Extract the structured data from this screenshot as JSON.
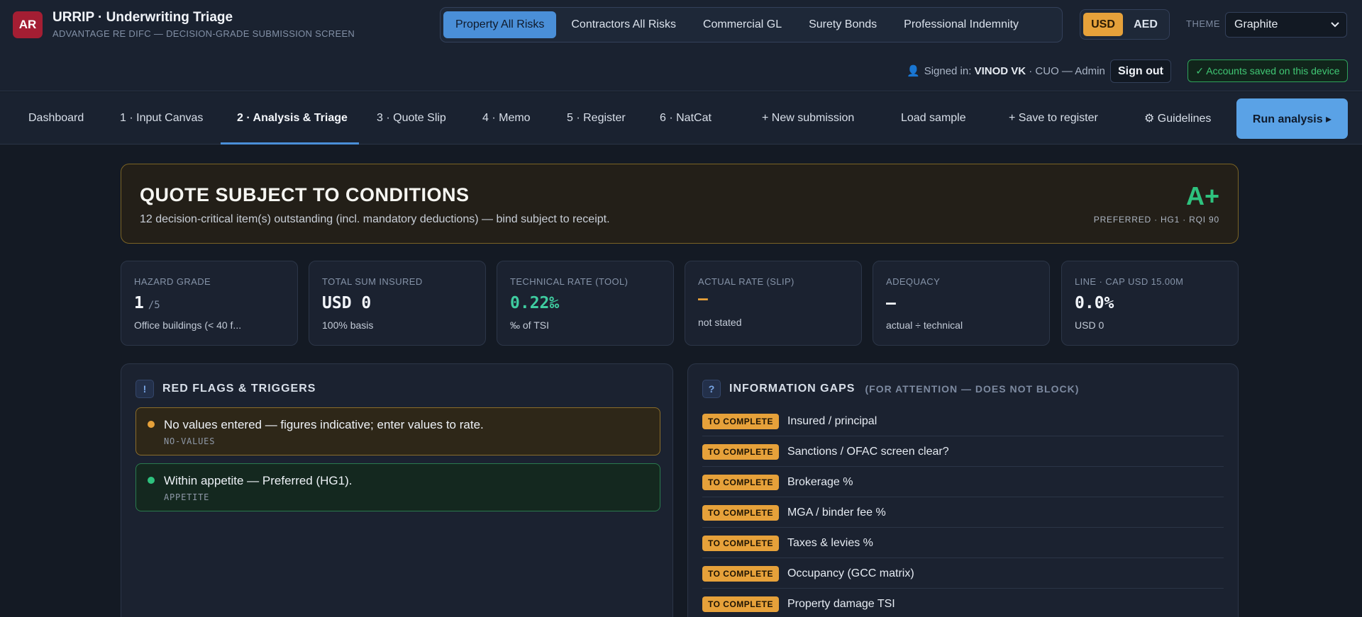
{
  "app": {
    "logo_text": "AR",
    "title": "URRIP · Underwriting Triage",
    "subtitle": "ADVANTAGE RE DIFC — DECISION-GRADE SUBMISSION SCREEN"
  },
  "lob_tabs": [
    {
      "label": "Property All Risks",
      "active": true
    },
    {
      "label": "Contractors All Risks",
      "active": false
    },
    {
      "label": "Commercial GL",
      "active": false
    },
    {
      "label": "Surety Bonds",
      "active": false
    },
    {
      "label": "Professional Indemnity",
      "active": false
    }
  ],
  "currency": {
    "options": [
      "USD",
      "AED"
    ],
    "selected": "USD"
  },
  "theme": {
    "label": "THEME",
    "value": "Graphite"
  },
  "user": {
    "signed_prefix": "Signed in:",
    "name": "VINOD VK",
    "role": "· CUO — Admin",
    "signout_label": "Sign out",
    "saved_status": "✓ Accounts saved on this device"
  },
  "nav": {
    "items": [
      {
        "label": "Dashboard"
      },
      {
        "label": "1 · Input Canvas"
      },
      {
        "label": "2 · Analysis & Triage"
      },
      {
        "label": "3 · Quote Slip"
      },
      {
        "label": "4 · Memo"
      },
      {
        "label": "5 · Register"
      },
      {
        "label": "6 · NatCat"
      }
    ],
    "active": "2 · Analysis & Triage",
    "actions": {
      "new_submission": "+ New submission",
      "load_sample": "Load sample",
      "save_register": "+ Save to register",
      "guidelines": "⚙ Guidelines",
      "run_analysis": "Run analysis ▸"
    }
  },
  "decision": {
    "title": "QUOTE SUBJECT TO CONDITIONS",
    "subtitle": "12 decision-critical item(s) outstanding (incl. mandatory deductions) — bind subject to receipt.",
    "grade": "A+",
    "grade_note": "PREFERRED · HG1 · RQI 90"
  },
  "kpis": [
    {
      "label": "HAZARD GRADE",
      "value": "1",
      "unit": "/5",
      "note": "Office buildings (< 40 f..."
    },
    {
      "label": "TOTAL SUM INSURED",
      "value": "USD 0",
      "unit": "",
      "note": "100% basis"
    },
    {
      "label": "TECHNICAL RATE (TOOL)",
      "value": "0.22‰",
      "unit": "",
      "note": "‰ of TSI"
    },
    {
      "label": "ACTUAL RATE (SLIP)",
      "value": "–",
      "unit": "",
      "note": "not stated"
    },
    {
      "label": "ADEQUACY",
      "value": "–",
      "unit": "",
      "note": "actual ÷ technical"
    },
    {
      "label": "LINE · CAP USD 15.00M",
      "value": "0.0%",
      "unit": "",
      "note": "USD 0"
    }
  ],
  "red_flags": {
    "icon_text": "!",
    "title": "RED FLAGS & TRIGGERS",
    "items": [
      {
        "text": "No values entered — figures indicative; enter values to rate.",
        "code": "NO-VALUES",
        "level": "warn"
      },
      {
        "text": "Within appetite — Preferred (HG1).",
        "code": "APPETITE",
        "level": "ok"
      }
    ]
  },
  "info_gaps": {
    "icon_text": "?",
    "title": "INFORMATION GAPS",
    "subtitle": "(FOR ATTENTION — DOES NOT BLOCK)",
    "badge_label": "TO COMPLETE",
    "items": [
      "Insured / principal",
      "Sanctions / OFAC screen clear?",
      "Brokerage %",
      "MGA / binder fee %",
      "Taxes & levies %",
      "Occupancy (GCC matrix)",
      "Property damage TSI"
    ]
  },
  "colors": {
    "accent_blue": "#4a8fd8",
    "amber": "#e6a13a",
    "green": "#2ec27e",
    "brand_red": "#a41e33",
    "background": "#141a24"
  }
}
